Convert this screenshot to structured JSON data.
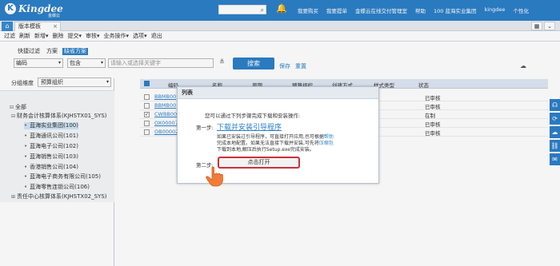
{
  "app": {
    "logo_text": "Kingdee",
    "logo_sub": "金蝶云",
    "nav": [
      "我要购买",
      "我要提单",
      "金蝶云在线交付管理室",
      "帮助",
      "100 蓝海实业集团",
      "kingdee",
      "个性化"
    ]
  },
  "tabs": {
    "home": "⌂",
    "current": "版本模板"
  },
  "toolbar": {
    "items": [
      "过滤",
      "刷新",
      "新增",
      "删除",
      "提交",
      "审核",
      "业务操作",
      "选项",
      "退出"
    ]
  },
  "filter": {
    "tabs": [
      "快捷过滤",
      "方案",
      "缺省方案"
    ],
    "field": "编码",
    "op": "包含",
    "keyword_placeholder": "请输入或选择关键字",
    "search_label": "搜索",
    "save": "保存",
    "reset": "重置"
  },
  "group": {
    "label": "分组维度",
    "value": "预算组织"
  },
  "tree": {
    "all": "全部",
    "sys1": "财务会计核算体系(KJHSTX01_SYS)",
    "orgs": [
      "蓝海实业集团(100)",
      "蓝海通讯公司(101)",
      "蓝海电子公司(102)",
      "蓝海销售公司(103)",
      "香港销售公司(104)",
      "蓝海电子商务有限公司(105)",
      "蓝海零售连锁公司(106)"
    ],
    "sys2": "责任中心核算体系(KJHSTX02_SYS)"
  },
  "grid": {
    "headers": [
      "编码",
      "名称",
      "周期",
      "预算组织",
      "创建方式",
      "样式类型",
      "状态"
    ],
    "rows": [
      {
        "code": "BBMB00",
        "status": "已审核",
        "checked": false
      },
      {
        "code": "BBMB00",
        "status": "已审核",
        "checked": false
      },
      {
        "code": "CWBB00",
        "status": "在制",
        "checked": true
      },
      {
        "code": "OX00007",
        "status": "已审核",
        "checked": false
      },
      {
        "code": "OB00002",
        "status": "已审核",
        "checked": false
      }
    ]
  },
  "dialog": {
    "title": "列表",
    "intro": "您可以通过下列步骤完成下载和安装操作:",
    "step1": "第一步:",
    "download_link": "下载并安装引导程序",
    "desc_a": "如果已安装过引导程序，可直接打开应用,也可根据",
    "desc_link1": "帮助",
    "desc_b": "完成本地配置。如果无法直接下载并安装,可先将",
    "desc_link2": "压缩包",
    "desc_c": "下载到本地,解压后执行Setup.exe完成安装。",
    "step2": "第二步:",
    "open_label": "点击打开"
  }
}
